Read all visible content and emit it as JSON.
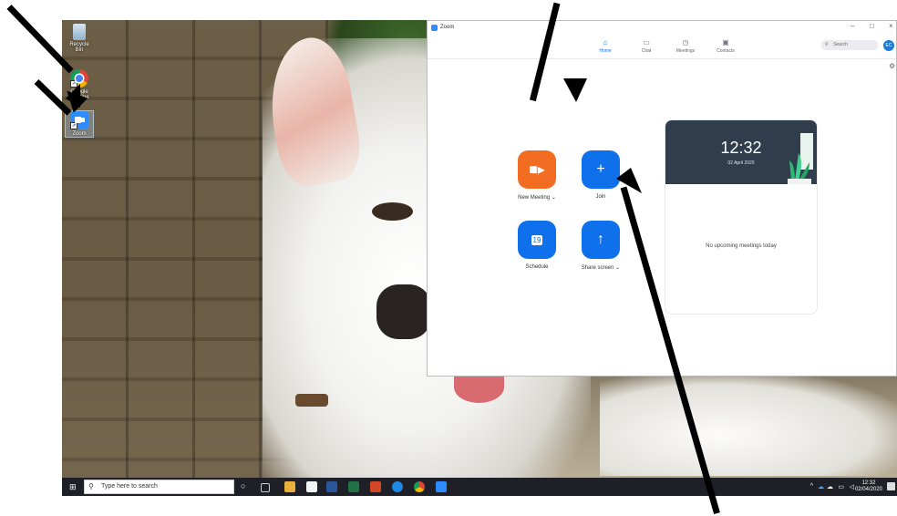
{
  "desktop": {
    "icons": [
      {
        "label": "Recycle Bin"
      },
      {
        "label": "Google Chrome"
      },
      {
        "label": "Zoom"
      }
    ]
  },
  "taskbar": {
    "search_placeholder": "Type here to search",
    "clock_time": "12:32",
    "clock_date": "02/04/2020"
  },
  "zoom": {
    "window_title": "Zoom",
    "nav": [
      {
        "label": "Home",
        "icon": "home-icon"
      },
      {
        "label": "Chat",
        "icon": "chat-icon"
      },
      {
        "label": "Meetings",
        "icon": "clock-icon"
      },
      {
        "label": "Contacts",
        "icon": "contacts-icon"
      }
    ],
    "search_placeholder": "Search",
    "avatar_initials": "EC",
    "actions": {
      "new_meeting": "New Meeting",
      "join": "Join",
      "schedule": "Schedule",
      "schedule_day": "19",
      "share_screen": "Share screen"
    },
    "calendar": {
      "time": "12:32",
      "date": "02 April 2020",
      "empty_text": "No upcoming meetings today"
    },
    "colors": {
      "accent": "#0e71eb",
      "orange": "#f26d21",
      "header": "#2f3d4d"
    }
  }
}
